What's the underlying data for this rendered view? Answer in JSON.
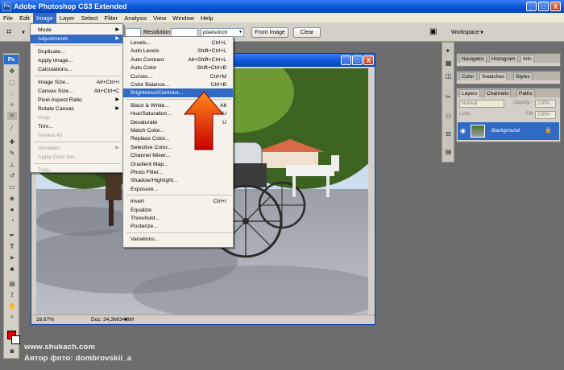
{
  "app": {
    "title": "Adobe Photoshop CS3 Extended",
    "logo": "Ps",
    "win_min": "_",
    "win_max": "□",
    "win_close": "X"
  },
  "menubar": [
    "File",
    "Edit",
    "Image",
    "Layer",
    "Select",
    "Filter",
    "Analysis",
    "View",
    "Window",
    "Help"
  ],
  "options_bar": {
    "resolution_label": "Resolution:",
    "unit_value": "pixels/inch",
    "front_image_label": "Front Image",
    "clear_label": "Clear",
    "workspace_label": "Workspace"
  },
  "image_menu": {
    "items": [
      {
        "label": "Mode",
        "shortcut": "",
        "arrow": "▶",
        "state": ""
      },
      {
        "label": "Adjustments",
        "shortcut": "",
        "arrow": "▶",
        "state": "hl"
      },
      {
        "label": "Duplicate...",
        "shortcut": "",
        "arrow": "",
        "state": ""
      },
      {
        "label": "Apply Image...",
        "shortcut": "",
        "arrow": "",
        "state": ""
      },
      {
        "label": "Calculations...",
        "shortcut": "",
        "arrow": "",
        "state": ""
      },
      {
        "label": "Image Size...",
        "shortcut": "Alt+Ctrl+I",
        "arrow": "",
        "state": ""
      },
      {
        "label": "Canvas Size...",
        "shortcut": "Alt+Ctrl+C",
        "arrow": "",
        "state": ""
      },
      {
        "label": "Pixel Aspect Ratio",
        "shortcut": "",
        "arrow": "▶",
        "state": ""
      },
      {
        "label": "Rotate Canvas",
        "shortcut": "",
        "arrow": "▶",
        "state": ""
      },
      {
        "label": "Crop",
        "shortcut": "",
        "arrow": "",
        "state": "dis"
      },
      {
        "label": "Trim...",
        "shortcut": "",
        "arrow": "",
        "state": ""
      },
      {
        "label": "Reveal All",
        "shortcut": "",
        "arrow": "",
        "state": "dis"
      },
      {
        "label": "Variables",
        "shortcut": "",
        "arrow": "▶",
        "state": "dis"
      },
      {
        "label": "Apply Data Set...",
        "shortcut": "",
        "arrow": "",
        "state": "dis"
      },
      {
        "label": "Trap...",
        "shortcut": "",
        "arrow": "",
        "state": "dis"
      }
    ]
  },
  "adjustments_menu": {
    "items": [
      {
        "label": "Levels...",
        "shortcut": "Ctrl+L",
        "state": ""
      },
      {
        "label": "Auto Levels",
        "shortcut": "Shift+Ctrl+L",
        "state": ""
      },
      {
        "label": "Auto Contrast",
        "shortcut": "Alt+Shift+Ctrl+L",
        "state": ""
      },
      {
        "label": "Auto Color",
        "shortcut": "Shift+Ctrl+B",
        "state": ""
      },
      {
        "label": "Curves...",
        "shortcut": "Ctrl+M",
        "state": ""
      },
      {
        "label": "Color Balance...",
        "shortcut": "Ctrl+B",
        "state": ""
      },
      {
        "label": "Brightness/Contrast...",
        "shortcut": "",
        "state": "hl"
      },
      {
        "label": "Black & White...",
        "shortcut": "Alt",
        "state": ""
      },
      {
        "label": "Hue/Saturation...",
        "shortcut": "U",
        "state": ""
      },
      {
        "label": "Desaturate",
        "shortcut": "U",
        "state": ""
      },
      {
        "label": "Match Color...",
        "shortcut": "",
        "state": ""
      },
      {
        "label": "Replace Color...",
        "shortcut": "",
        "state": ""
      },
      {
        "label": "Selective Color...",
        "shortcut": "",
        "state": ""
      },
      {
        "label": "Channel Mixer...",
        "shortcut": "",
        "state": ""
      },
      {
        "label": "Gradient Map...",
        "shortcut": "",
        "state": ""
      },
      {
        "label": "Photo Filter...",
        "shortcut": "",
        "state": ""
      },
      {
        "label": "Shadow/Highlight...",
        "shortcut": "",
        "state": ""
      },
      {
        "label": "Exposure...",
        "shortcut": "",
        "state": ""
      },
      {
        "label": "Invert",
        "shortcut": "Ctrl+I",
        "state": ""
      },
      {
        "label": "Equalize",
        "shortcut": "",
        "state": ""
      },
      {
        "label": "Threshold...",
        "shortcut": "",
        "state": ""
      },
      {
        "label": "Posterize...",
        "shortcut": "",
        "state": ""
      },
      {
        "label": "Variations...",
        "shortcut": "",
        "state": ""
      }
    ]
  },
  "document": {
    "zoom": "16.67%",
    "doc_size": "Doc: 34,3M/34,3M"
  },
  "panels": {
    "group1_tabs": [
      "Navigator",
      "Histogram",
      "Info"
    ],
    "group2_tabs": [
      "Color",
      "Swatches",
      "Styles"
    ],
    "layers_tabs": [
      "Layers",
      "Channels",
      "Paths"
    ],
    "blend_mode": "Normal",
    "opacity_label": "Opacity:",
    "opacity_value": "100%",
    "lock_label": "Lock:",
    "fill_label": "Fill:",
    "fill_value": "100%",
    "layer_name": "Background"
  },
  "watermark": {
    "line1": "www.shukach.com",
    "line2": "Автор фото: dombrovskii_a"
  },
  "colors": {
    "accent": "#316ac5",
    "foreground": "#e60000",
    "background": "#ffffff",
    "arrow": "#e23a00"
  }
}
